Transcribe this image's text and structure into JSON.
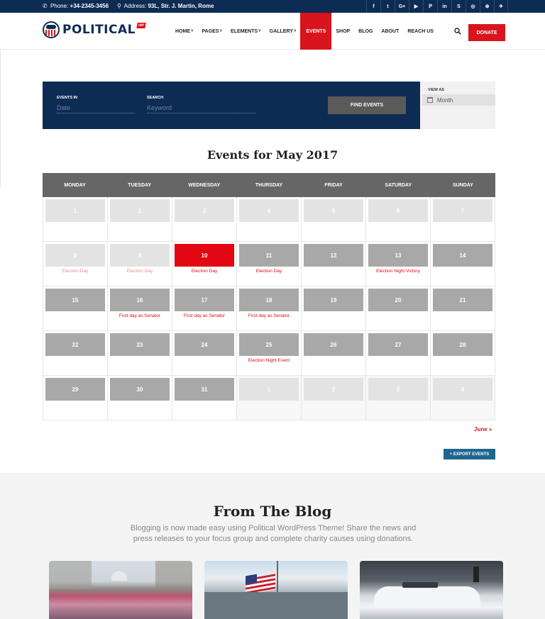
{
  "topbar": {
    "phone_label": "Phone:",
    "phone_value": "+34-2345-3456",
    "address_label": "Address:",
    "address_value": "93L, Str. J. Martin, Rome",
    "socials": [
      "f",
      "t",
      "G+",
      "▶",
      "ℙ",
      "in",
      "S",
      "◎",
      "⊛",
      "✈"
    ]
  },
  "header": {
    "logo_text": "POLITICAL",
    "logo_badge": "WP",
    "nav": [
      {
        "label": "HOME",
        "dropdown": true
      },
      {
        "label": "PAGES",
        "dropdown": true
      },
      {
        "label": "ELEMENTS",
        "dropdown": true
      },
      {
        "label": "GALLERY",
        "dropdown": true
      },
      {
        "label": "EVENTS",
        "dropdown": false,
        "active": true
      },
      {
        "label": "SHOP",
        "dropdown": false
      },
      {
        "label": "BLOG",
        "dropdown": false
      },
      {
        "label": "ABOUT",
        "dropdown": false
      },
      {
        "label": "REACH US",
        "dropdown": false
      }
    ],
    "donate_label": "DONATE"
  },
  "event_bar": {
    "events_in_label": "EVENTS IN",
    "events_in_placeholder": "Date",
    "search_label": "SEARCH",
    "search_placeholder": "Keyword",
    "find_label": "FIND EVENTS",
    "view_as_label": "VIEW AS",
    "view_as_value": "Month"
  },
  "calendar": {
    "title": "Events for May 2017",
    "days": [
      "MONDAY",
      "TUESDAY",
      "WEDNESDAY",
      "THURSDAY",
      "FRIDAY",
      "SATURDAY",
      "SUNDAY"
    ],
    "weeks": [
      [
        {
          "d": "1",
          "s": "past"
        },
        {
          "d": "2",
          "s": "past"
        },
        {
          "d": "3",
          "s": "past"
        },
        {
          "d": "4",
          "s": "past"
        },
        {
          "d": "5",
          "s": "past"
        },
        {
          "d": "6",
          "s": "past"
        },
        {
          "d": "7",
          "s": "past"
        }
      ],
      [
        {
          "d": "8",
          "s": "past",
          "e": "Election Day"
        },
        {
          "d": "9",
          "s": "past",
          "e": "Election Day"
        },
        {
          "d": "10",
          "s": "today",
          "e": "Election Day"
        },
        {
          "d": "11",
          "s": "",
          "e": "Election Day"
        },
        {
          "d": "12",
          "s": ""
        },
        {
          "d": "13",
          "s": "",
          "e": "Election Night Victory"
        },
        {
          "d": "14",
          "s": ""
        }
      ],
      [
        {
          "d": "15",
          "s": ""
        },
        {
          "d": "16",
          "s": "",
          "e": "First day as Senator"
        },
        {
          "d": "17",
          "s": "",
          "e": "First day as Senator"
        },
        {
          "d": "18",
          "s": "",
          "e": "First day as Senator"
        },
        {
          "d": "19",
          "s": ""
        },
        {
          "d": "20",
          "s": ""
        },
        {
          "d": "21",
          "s": ""
        }
      ],
      [
        {
          "d": "22",
          "s": ""
        },
        {
          "d": "23",
          "s": ""
        },
        {
          "d": "24",
          "s": ""
        },
        {
          "d": "25",
          "s": "",
          "e": "Election Night Event"
        },
        {
          "d": "26",
          "s": ""
        },
        {
          "d": "27",
          "s": ""
        },
        {
          "d": "28",
          "s": ""
        }
      ],
      [
        {
          "d": "29",
          "s": ""
        },
        {
          "d": "30",
          "s": ""
        },
        {
          "d": "31",
          "s": ""
        },
        {
          "d": "1",
          "s": "other"
        },
        {
          "d": "2",
          "s": "other"
        },
        {
          "d": "3",
          "s": "other"
        },
        {
          "d": "4",
          "s": "other"
        }
      ]
    ],
    "next_label": "June »",
    "export_label": "+ EXPORT EVENTS"
  },
  "blog": {
    "title": "From The Blog",
    "description": "Blogging is now made easy using Political WordPress Theme! Share the news and press releases to your focus group and complete charity causes using donations."
  },
  "colors": {
    "navy": "#0d2c54",
    "red": "#d9141c",
    "export_blue": "#1f6690"
  }
}
